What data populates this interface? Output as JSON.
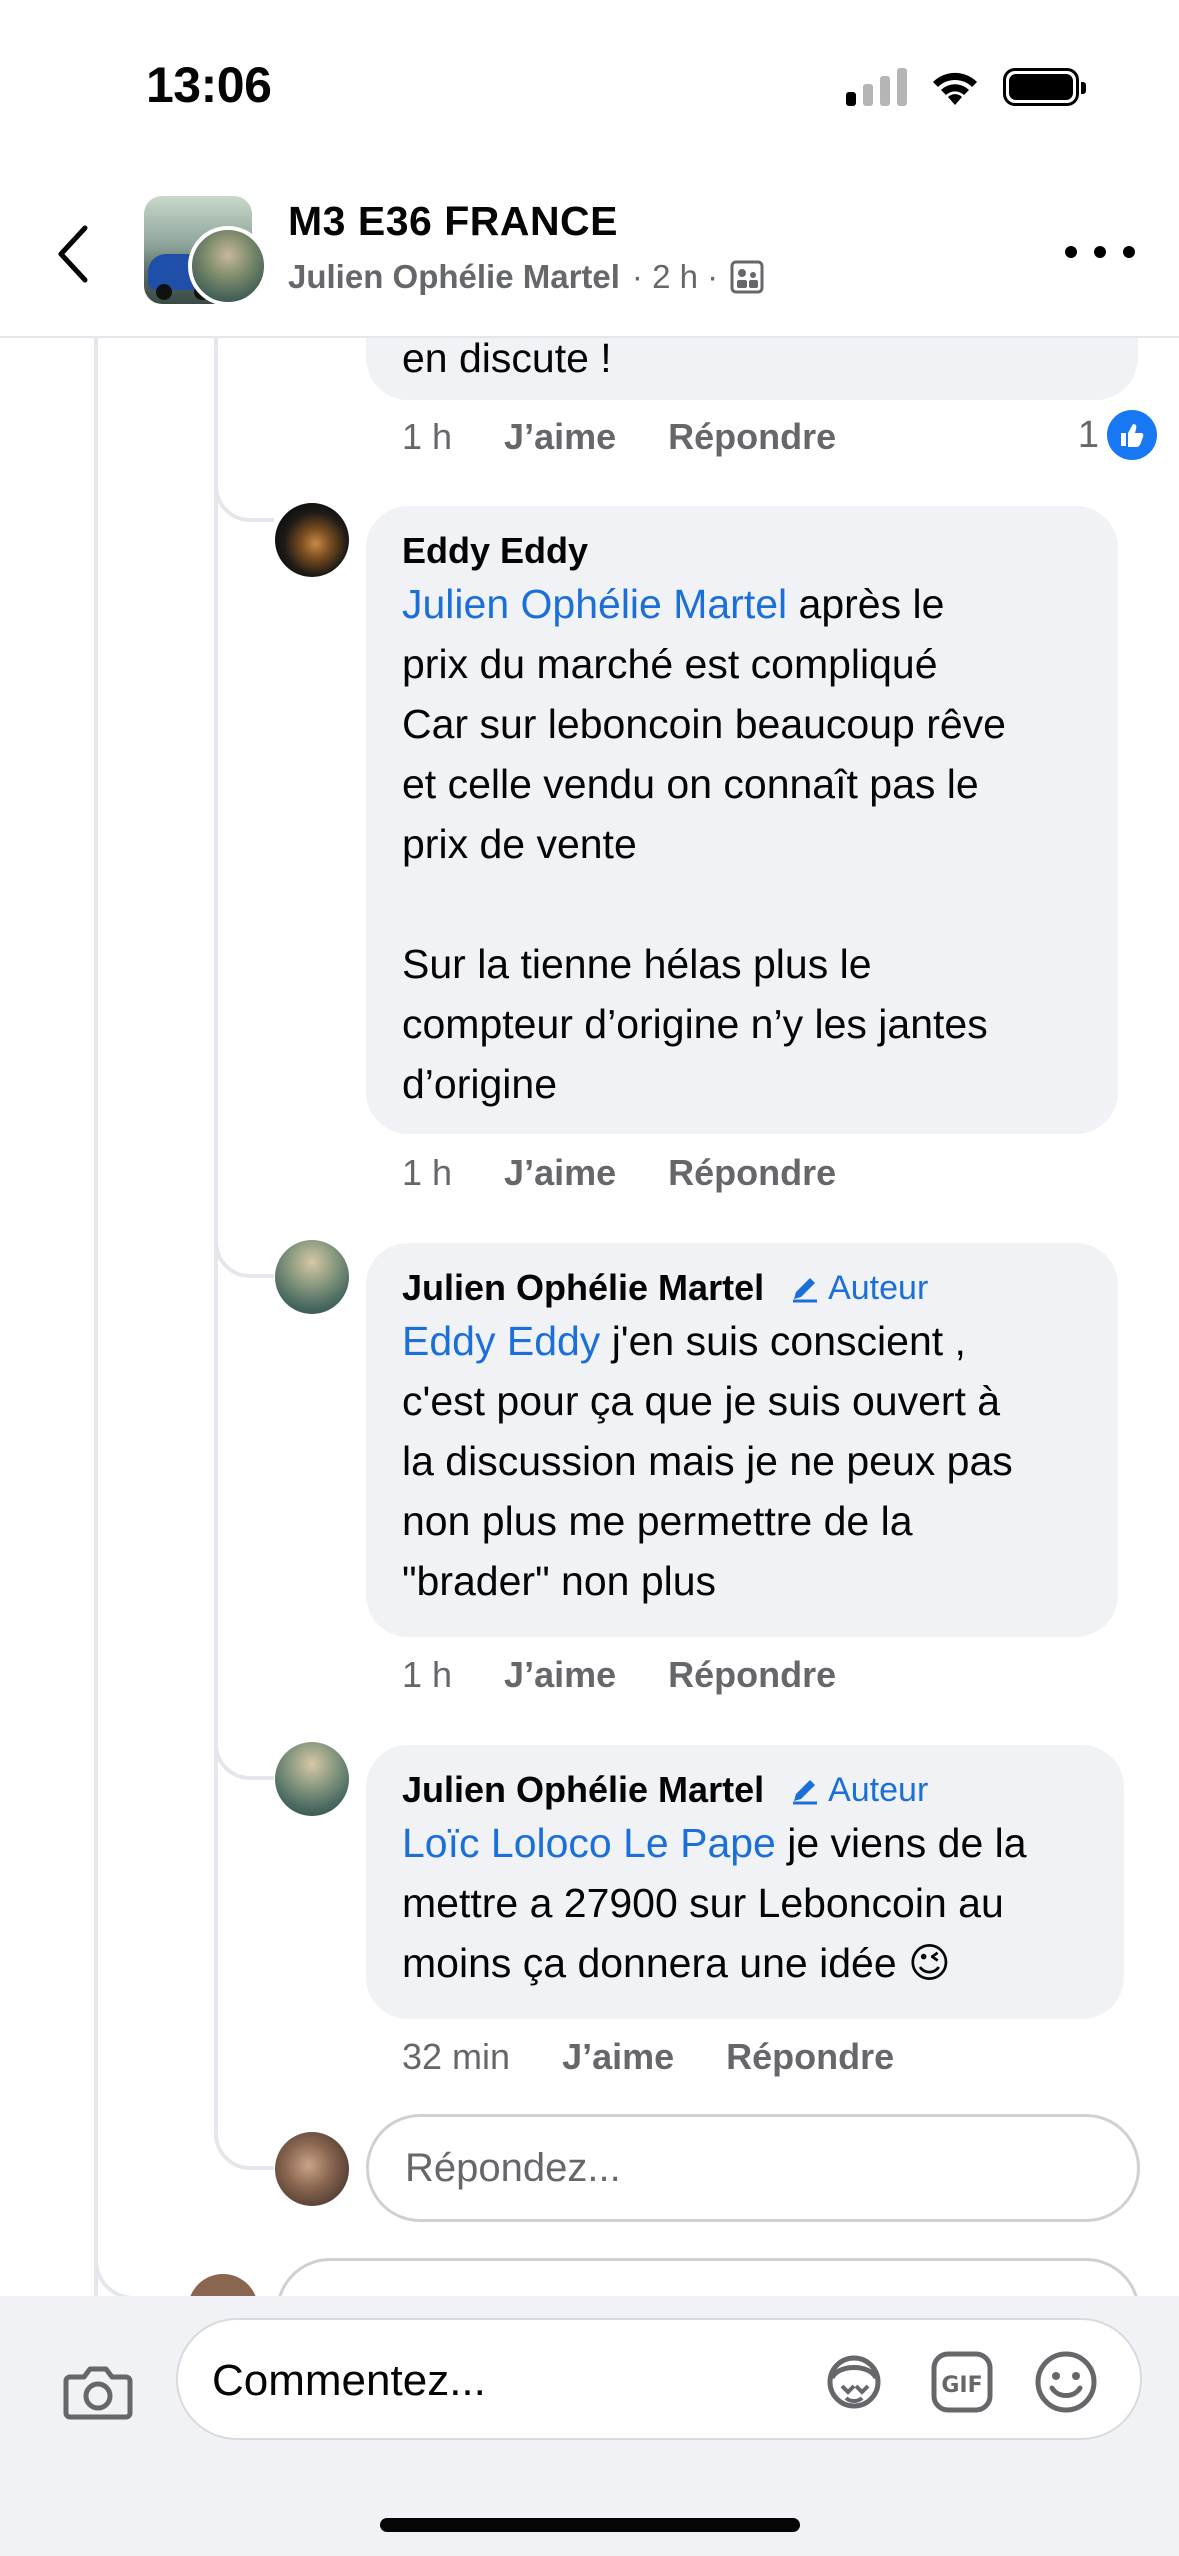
{
  "status_bar": {
    "time": "13:06"
  },
  "header": {
    "group_name": "M3 E36 FRANCE",
    "author": "Julien Ophélie Martel",
    "meta": "· 2 h ·"
  },
  "top_comment_tail": {
    "text": "en discute !",
    "time": "1 h",
    "like_label": "J’aime",
    "reply_label": "Répondre",
    "reaction_count": "1"
  },
  "comments": [
    {
      "author": "Eddy Eddy",
      "mention": "Julien Ophélie Martel",
      "text": " après le\nprix du marché est compliqué\nCar sur leboncoin beaucoup rêve\net celle vendu on connaît pas le\nprix de vente\n\nSur la tienne hélas plus le\ncompteur d’origine n’y les jantes\nd’origine",
      "time": "1 h",
      "like_label": "J’aime",
      "reply_label": "Répondre"
    },
    {
      "author": "Julien Ophélie Martel",
      "badge": "Auteur",
      "mention": "Eddy Eddy",
      "text": " j'en suis conscient ,\nc'est pour ça que je suis ouvert à\nla discussion mais je ne peux pas\nnon plus me permettre de la\n\"brader\" non plus",
      "time": "1 h",
      "like_label": "J’aime",
      "reply_label": "Répondre"
    },
    {
      "author": "Julien Ophélie Martel",
      "badge": "Auteur",
      "mention": "Loïc Loloco Le Pape",
      "text": " je viens de la\nmettre a 27900 sur Leboncoin au\nmoins ça donnera une idée 😉",
      "time": "32 min",
      "like_label": "J’aime",
      "reply_label": "Répondre"
    }
  ],
  "reply_input": {
    "placeholder": "Répondez..."
  },
  "composer": {
    "placeholder": "Commentez..."
  },
  "colors": {
    "link": "#1b6fd8",
    "bubble": "#f0f2f5",
    "secondary_text": "#65676b",
    "like_blue": "#1877f2"
  },
  "icons": [
    "back-chevron-icon",
    "group-photo-icon",
    "more-icon",
    "like-icon",
    "pencil-icon",
    "camera-icon",
    "avatar-sticker-icon",
    "gif-icon",
    "emoji-icon",
    "wifi-icon",
    "signal-icon",
    "battery-icon"
  ]
}
